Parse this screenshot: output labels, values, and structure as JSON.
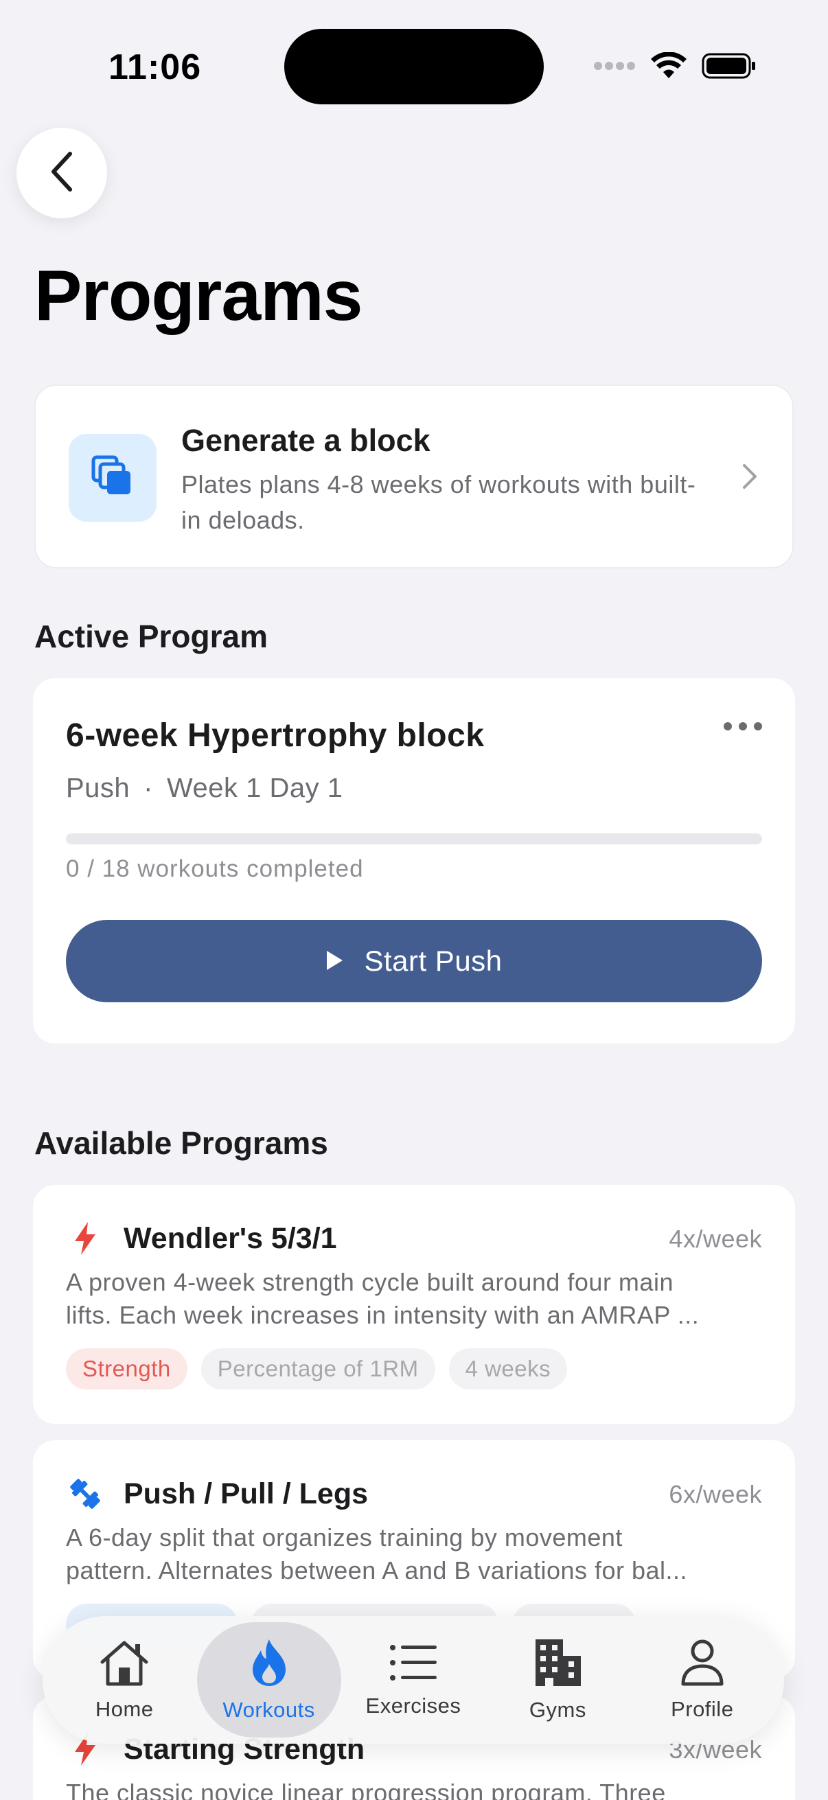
{
  "status_bar": {
    "time": "11:06"
  },
  "page": {
    "title": "Programs"
  },
  "generate": {
    "title": "Generate a block",
    "description": "Plates plans 4-8 weeks of workouts with built-in deloads."
  },
  "active_section": {
    "title": "Active Program"
  },
  "active_program": {
    "name": "6-week Hypertrophy block",
    "workout": "Push",
    "separator": "·",
    "schedule": "Week 1 Day 1",
    "completed": 0,
    "total": 18,
    "progress_text": "0 / 18 workouts completed",
    "start_label": "Start Push"
  },
  "available_section": {
    "title": "Available Programs"
  },
  "programs": [
    {
      "name": "Wendler's 5/3/1",
      "frequency": "4x/week",
      "icon": "bolt-icon",
      "desc_line1": "A proven 4-week strength cycle built around four main",
      "desc_line2": "lifts. Each week increases in intensity with an AMRAP ...",
      "tags": [
        "Strength",
        "Percentage of 1RM",
        "4 weeks"
      ]
    },
    {
      "name": "Push / Pull / Legs",
      "frequency": "6x/week",
      "icon": "dumbbell-icon",
      "desc_line1": "A 6-day split that organizes training by movement",
      "desc_line2": "pattern. Alternates between A and B variations for bal...",
      "tags": [
        "",
        "",
        ""
      ]
    },
    {
      "name": "Starting Strength",
      "frequency": "3x/week",
      "icon": "bolt-icon",
      "desc_line1": "The classic novice linear progression program. Three"
    }
  ],
  "tabs": [
    {
      "label": "Home",
      "icon": "house-icon"
    },
    {
      "label": "Workouts",
      "icon": "flame-icon",
      "active": true
    },
    {
      "label": "Exercises",
      "icon": "list-icon"
    },
    {
      "label": "Gyms",
      "icon": "building-icon"
    },
    {
      "label": "Profile",
      "icon": "person-icon"
    }
  ],
  "colors": {
    "accent": "#1a73e8",
    "primary_button": "#445d91",
    "strength_red": "#e8453c",
    "background": "#f2f2f7"
  }
}
